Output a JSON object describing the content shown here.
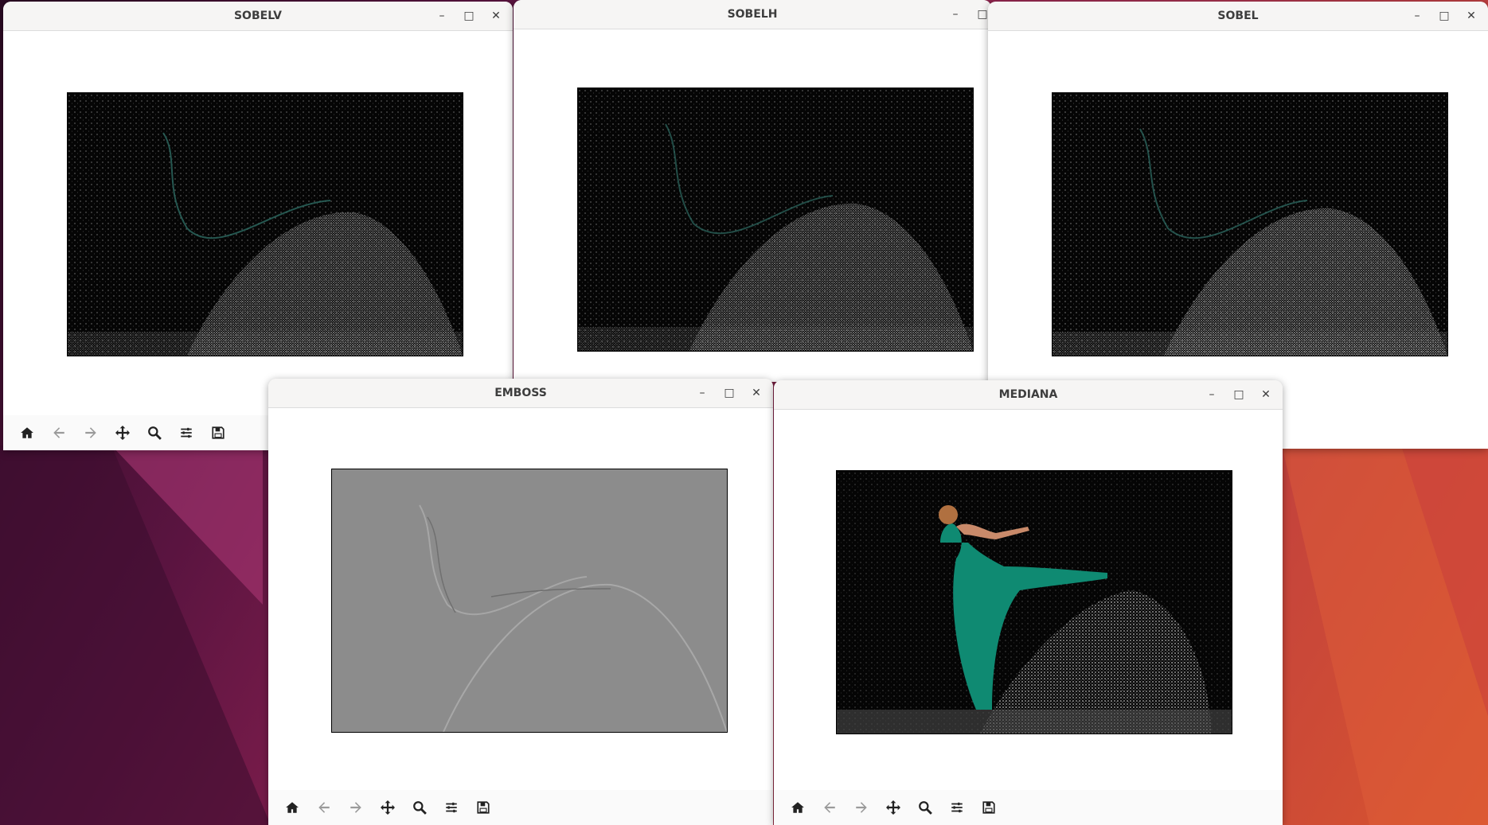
{
  "desktop": {
    "accent": "#9a2a5a",
    "accent2": "#d9552e"
  },
  "windows": [
    {
      "id": "sobelv",
      "title": "SOBELV"
    },
    {
      "id": "sobelh",
      "title": "SOBELH"
    },
    {
      "id": "sobel",
      "title": "SOBEL"
    },
    {
      "id": "emboss",
      "title": "EMBOSS"
    },
    {
      "id": "mediana",
      "title": "MEDIANA"
    }
  ],
  "window_controls": {
    "minimize": "–",
    "maximize": "□",
    "close": "✕"
  },
  "toolbar_icons": [
    "home-icon",
    "back-arrow-icon",
    "forward-arrow-icon",
    "pan-icon",
    "zoom-icon",
    "configure-subplots-icon",
    "save-icon"
  ],
  "image_panels": {
    "sobelv": {
      "subject": "edge-filtered dancer splash",
      "filter": "sobel-vertical"
    },
    "sobelh": {
      "subject": "edge-filtered dancer splash",
      "filter": "sobel-horizontal"
    },
    "sobel": {
      "subject": "edge-filtered dancer splash",
      "filter": "sobel"
    },
    "emboss": {
      "subject": "embossed dancer splash",
      "filter": "emboss"
    },
    "mediana": {
      "subject": "dancer in green dress with water splash",
      "filter": "median"
    }
  }
}
